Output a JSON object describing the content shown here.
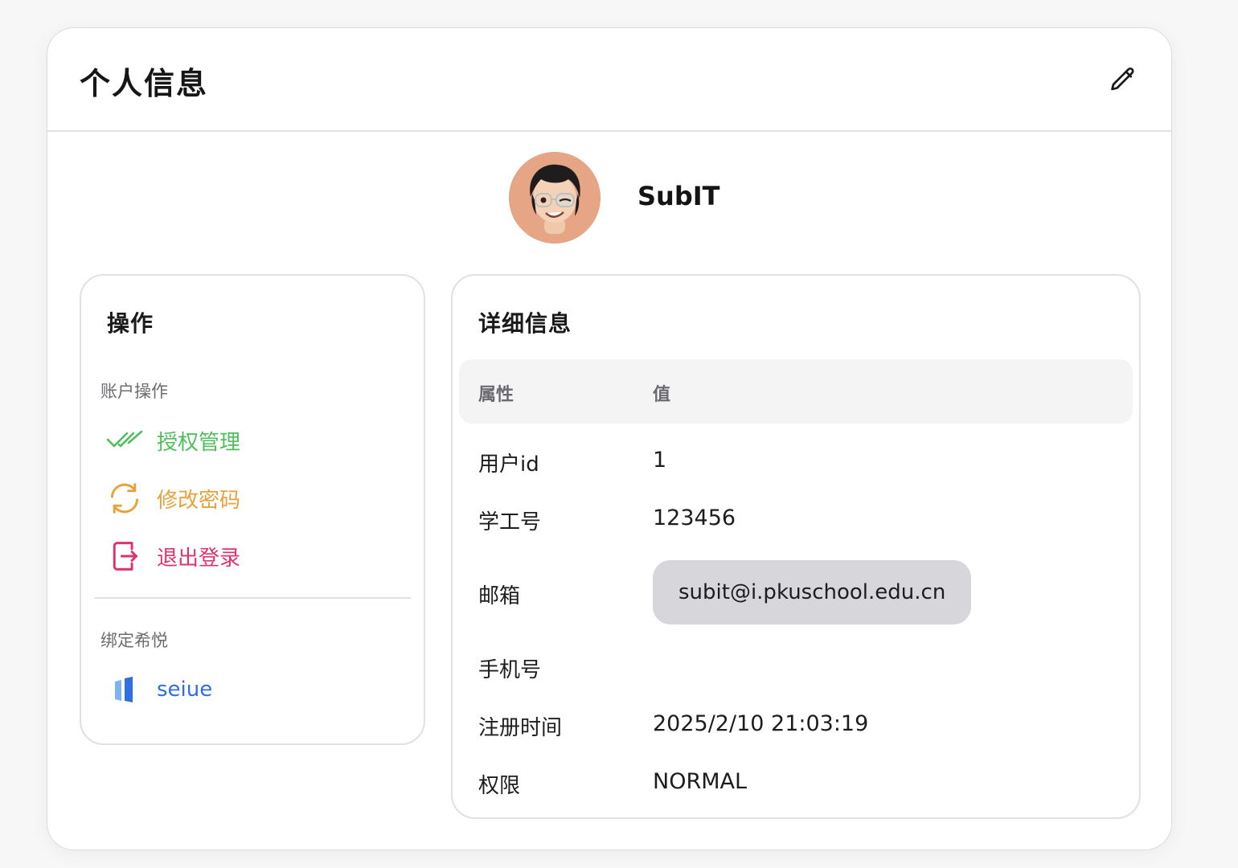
{
  "header": {
    "title": "个人信息",
    "edit_icon": "pencil-icon"
  },
  "profile": {
    "name": "SubIT",
    "avatar_icon": "memoji-avatar"
  },
  "ops": {
    "title": "操作",
    "account_section": "账户操作",
    "items": [
      {
        "label": "授权管理",
        "icon": "double-check-icon",
        "color": "#4dbf5b"
      },
      {
        "label": "修改密码",
        "icon": "refresh-icon",
        "color": "#e9a23b"
      },
      {
        "label": "退出登录",
        "icon": "logout-icon",
        "color": "#e0336b"
      }
    ],
    "bind_section": "绑定希悦",
    "bind_item": {
      "label": "seiue",
      "icon": "seiue-logo-icon",
      "color": "#2f6fe0"
    }
  },
  "detail": {
    "title": "详细信息",
    "columns": [
      "属性",
      "值"
    ],
    "rows": [
      {
        "key": "用户id",
        "value": "1"
      },
      {
        "key": "学工号",
        "value": "123456"
      },
      {
        "key": "邮箱",
        "value": "subit@i.pkuschool.edu.cn"
      },
      {
        "key": "手机号",
        "value": ""
      },
      {
        "key": "注册时间",
        "value": "2025/2/10 21:03:19"
      },
      {
        "key": "权限",
        "value": "NORMAL"
      }
    ]
  }
}
